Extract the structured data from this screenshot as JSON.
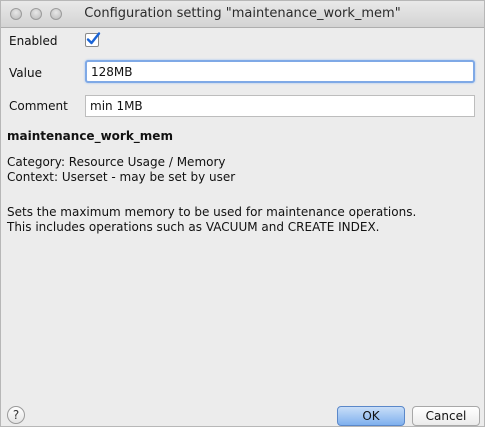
{
  "window": {
    "title": "Configuration setting \"maintenance_work_mem\""
  },
  "form": {
    "enabled_label": "Enabled",
    "enabled_checked": true,
    "value_label": "Value",
    "value": "128MB",
    "comment_label": "Comment",
    "comment": "min 1MB"
  },
  "details": {
    "name": "maintenance_work_mem",
    "category": "Category: Resource Usage / Memory",
    "context": "Context: Userset - may be set by user",
    "description_line1": "Sets the maximum memory to be used for maintenance operations.",
    "description_line2": "This includes operations such as VACUUM and CREATE INDEX."
  },
  "buttons": {
    "help": "?",
    "ok": "OK",
    "cancel": "Cancel"
  },
  "colors": {
    "accent": "#1a64d6",
    "focus_ring": "#7fa9e6",
    "default_button": "#7fb0ee"
  }
}
